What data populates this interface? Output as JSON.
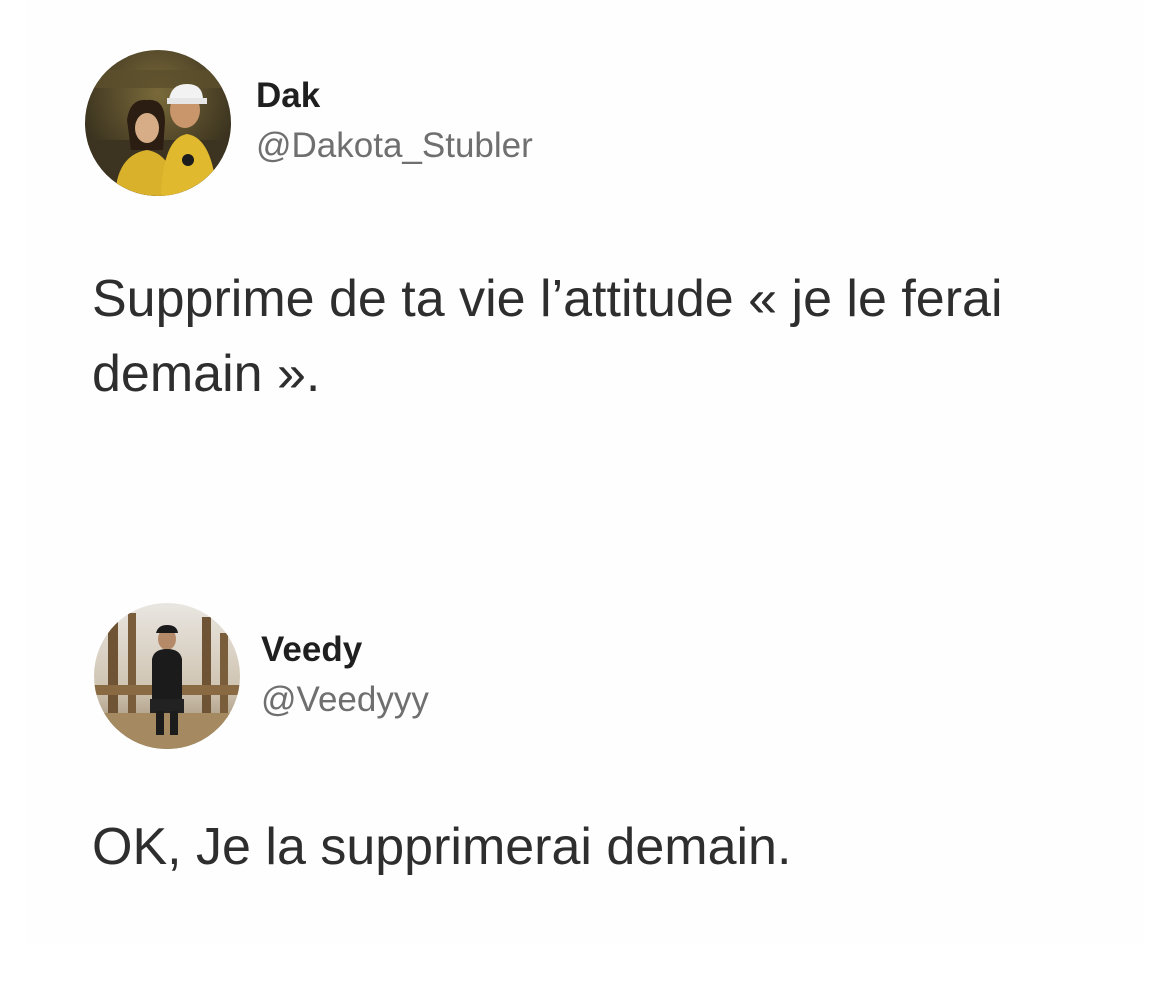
{
  "tweets": [
    {
      "author_name": "Dak",
      "author_handle": "@Dakota_Stubler",
      "text": "Supprime de ta vie l’attitude « je le ferai demain »."
    },
    {
      "author_name": "Veedy",
      "author_handle": "@Veedyyy",
      "text": "OK, Je la supprimerai demain."
    }
  ]
}
